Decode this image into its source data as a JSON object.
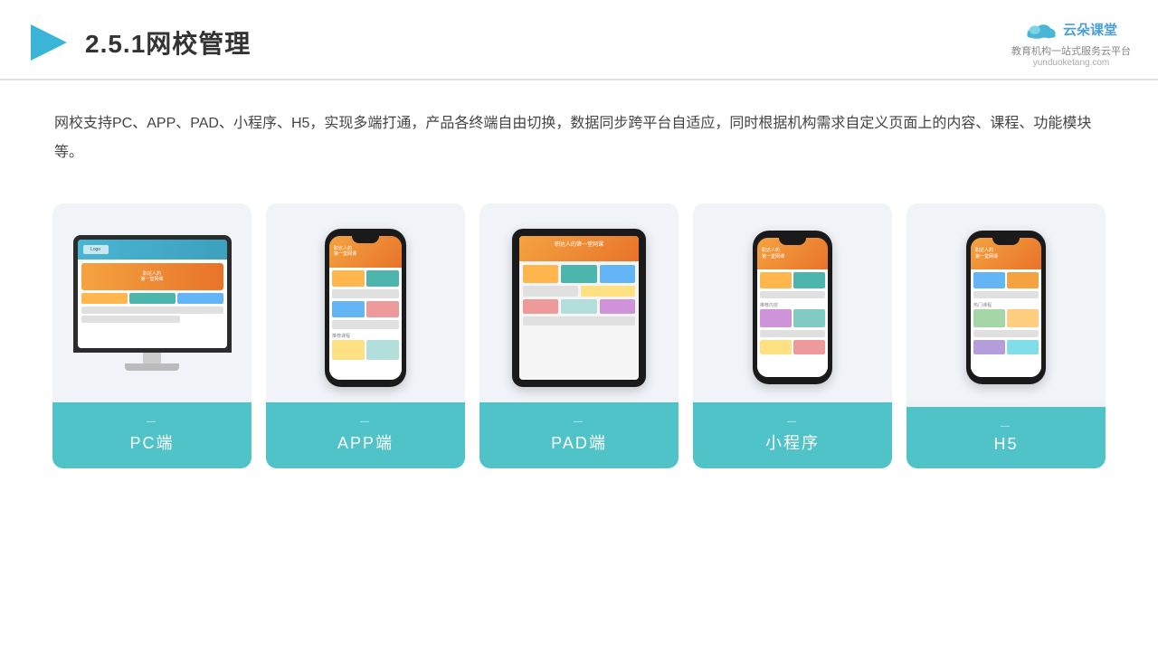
{
  "header": {
    "title": "2.5.1网校管理",
    "logo_name": "云朵课堂",
    "logo_url": "yunduoketang.com",
    "logo_tagline": "教育机构一站\n式服务云平台"
  },
  "description": {
    "text": "网校支持PC、APP、PAD、小程序、H5，实现多端打通，产品各终端自由切换，数据同步跨平台自适应，同时根据机构需求自定义页面上的内容、课程、功能模块等。"
  },
  "cards": [
    {
      "id": "pc",
      "label": "PC端"
    },
    {
      "id": "app",
      "label": "APP端"
    },
    {
      "id": "pad",
      "label": "PAD端"
    },
    {
      "id": "miniapp",
      "label": "小程序"
    },
    {
      "id": "h5",
      "label": "H5"
    }
  ],
  "colors": {
    "teal": "#4fc3c8",
    "accent_orange": "#f4a340",
    "card_bg": "#eef2f7",
    "header_blue": "#4ab5d4"
  }
}
